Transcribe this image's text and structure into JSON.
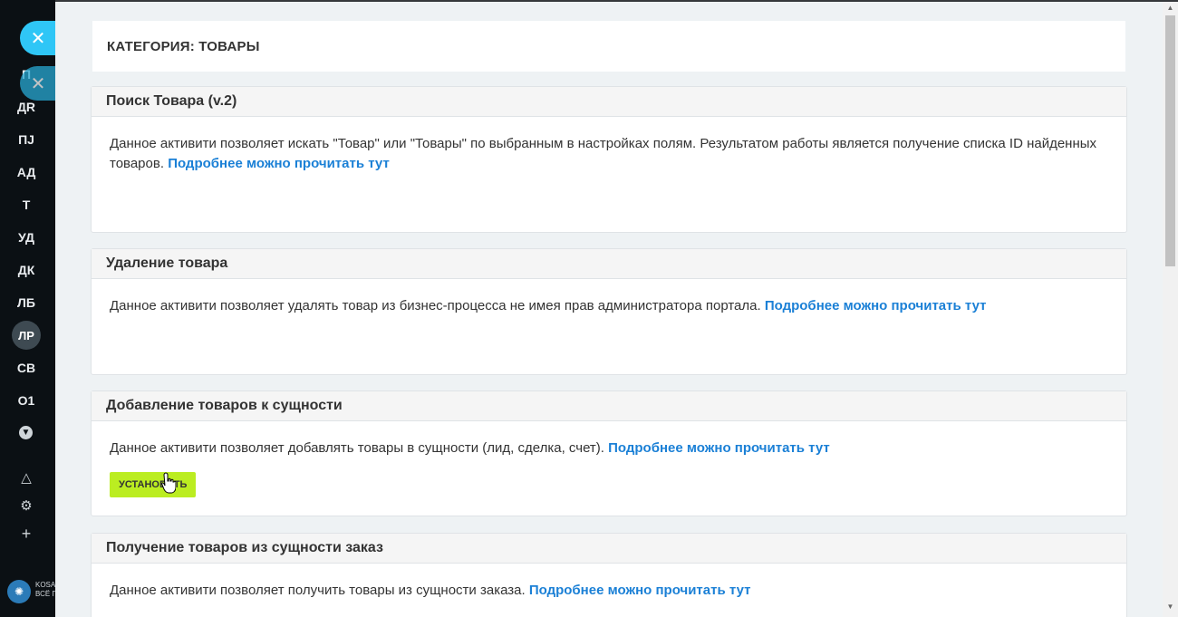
{
  "sidebar": {
    "items": [
      "П",
      "ДR",
      "ПJ",
      "АД",
      "Т",
      "УД",
      "ДК",
      "ЛБ",
      "ЛР",
      "СВ",
      "О1"
    ],
    "logo_text_line1": "KOSA",
    "logo_text_line2": "ВСЁ Г"
  },
  "header": {
    "title": "КАТЕГОРИЯ: ТОВАРЫ"
  },
  "cards": [
    {
      "title": "Поиск Товара (v.2)",
      "text": "Данное активити позволяет искать \"Товар\" или \"Товары\" по выбранным в настройках полям. Результатом работы является получение списка ID найденных товаров.",
      "link": "Подробнее можно прочитать тут"
    },
    {
      "title": "Удаление товара",
      "text": "Данное активити позволяет удалять товар из бизнес-процесса не имея прав администратора портала.",
      "link": "Подробнее можно прочитать тут"
    },
    {
      "title": "Добавление товаров к сущности",
      "text": "Данное активити позволяет добавлять товары в сущности (лид, сделка, счет).",
      "link": "Подробнее можно прочитать тут",
      "button": "УСТАНОВИТЬ"
    },
    {
      "title": "Получение товаров из сущности заказ",
      "text": "Данное активити позволяет получить товары из сущности заказа.",
      "link": "Подробнее можно прочитать тут"
    }
  ],
  "colors": {
    "accent_link": "#1b80d6",
    "install_button": "#bbed21",
    "close_button": "#2fc6f6"
  }
}
